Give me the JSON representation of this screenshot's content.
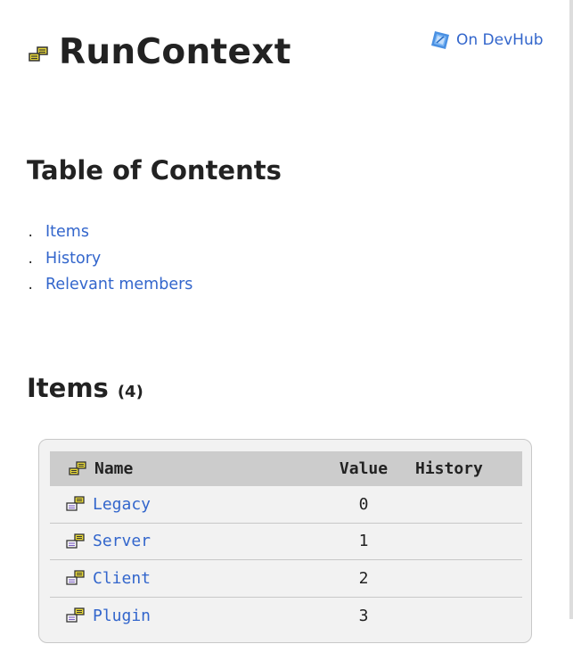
{
  "header": {
    "title": "RunContext",
    "icon": "enum-icon",
    "devhub_label": "On DevHub",
    "devhub_icon": "devhub-logo-icon"
  },
  "toc": {
    "heading": "Table of Contents",
    "bullet": ".",
    "items": [
      {
        "label": "Items"
      },
      {
        "label": "History"
      },
      {
        "label": "Relevant members"
      }
    ]
  },
  "items_section": {
    "title": "Items",
    "count": "(4)",
    "columns": {
      "name": "Name",
      "value": "Value",
      "history": "History"
    },
    "rows": [
      {
        "name": "Legacy",
        "value": "0",
        "icon": "enum-item-icon"
      },
      {
        "name": "Server",
        "value": "1",
        "icon": "enum-item-icon"
      },
      {
        "name": "Client",
        "value": "2",
        "icon": "enum-item-icon"
      },
      {
        "name": "Plugin",
        "value": "3",
        "icon": "enum-item-icon"
      }
    ]
  },
  "colors": {
    "link": "#3366cc",
    "text": "#222222",
    "table_header_bg": "#cccccc",
    "table_bg": "#f2f2f2",
    "icon_yellow": "#e8d93a"
  }
}
